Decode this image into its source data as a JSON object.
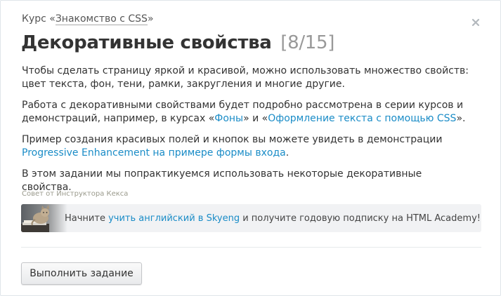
{
  "header": {
    "course_prefix": "Курс «",
    "course_name": "Знакомство с CSS",
    "course_suffix": "»",
    "title": "Декоративные свойства",
    "counter": "[8/15]",
    "close_icon": "close-icon"
  },
  "content": {
    "p1": "Чтобы сделать страницу яркой и красивой, можно использовать множество свойств: цвет текста, фон, тени, рамки, закругления и многие другие.",
    "p2_part1": "Работа с декоративными свойствами будет подробно рассмотрена в серии курсов и демонстраций, например, в курсах «",
    "p2_link1": "Фоны",
    "p2_part2": "» и «",
    "p2_link2": "Оформление текста с помощью CSS",
    "p2_part3": "».",
    "p3_part1": "Пример создания красивых полей и кнопок вы можете увидеть в демонстрации ",
    "p3_link": "Progressive Enhancement на примере формы входа",
    "p3_part2": ".",
    "p4": "В этом задании мы попрактикуемся использовать некоторые декоративные свойства."
  },
  "tip": {
    "label": "Совет от Инструктора Кекса",
    "text_part1": "Начните ",
    "link": "учить английский в Skyeng",
    "text_part2": " и получите годовую подписку на HTML Academy!"
  },
  "actions": {
    "submit_label": "Выполнить задание"
  },
  "colors": {
    "link": "#1a8cc7",
    "tip_background": "#f1f2f4",
    "counter": "#999999"
  }
}
